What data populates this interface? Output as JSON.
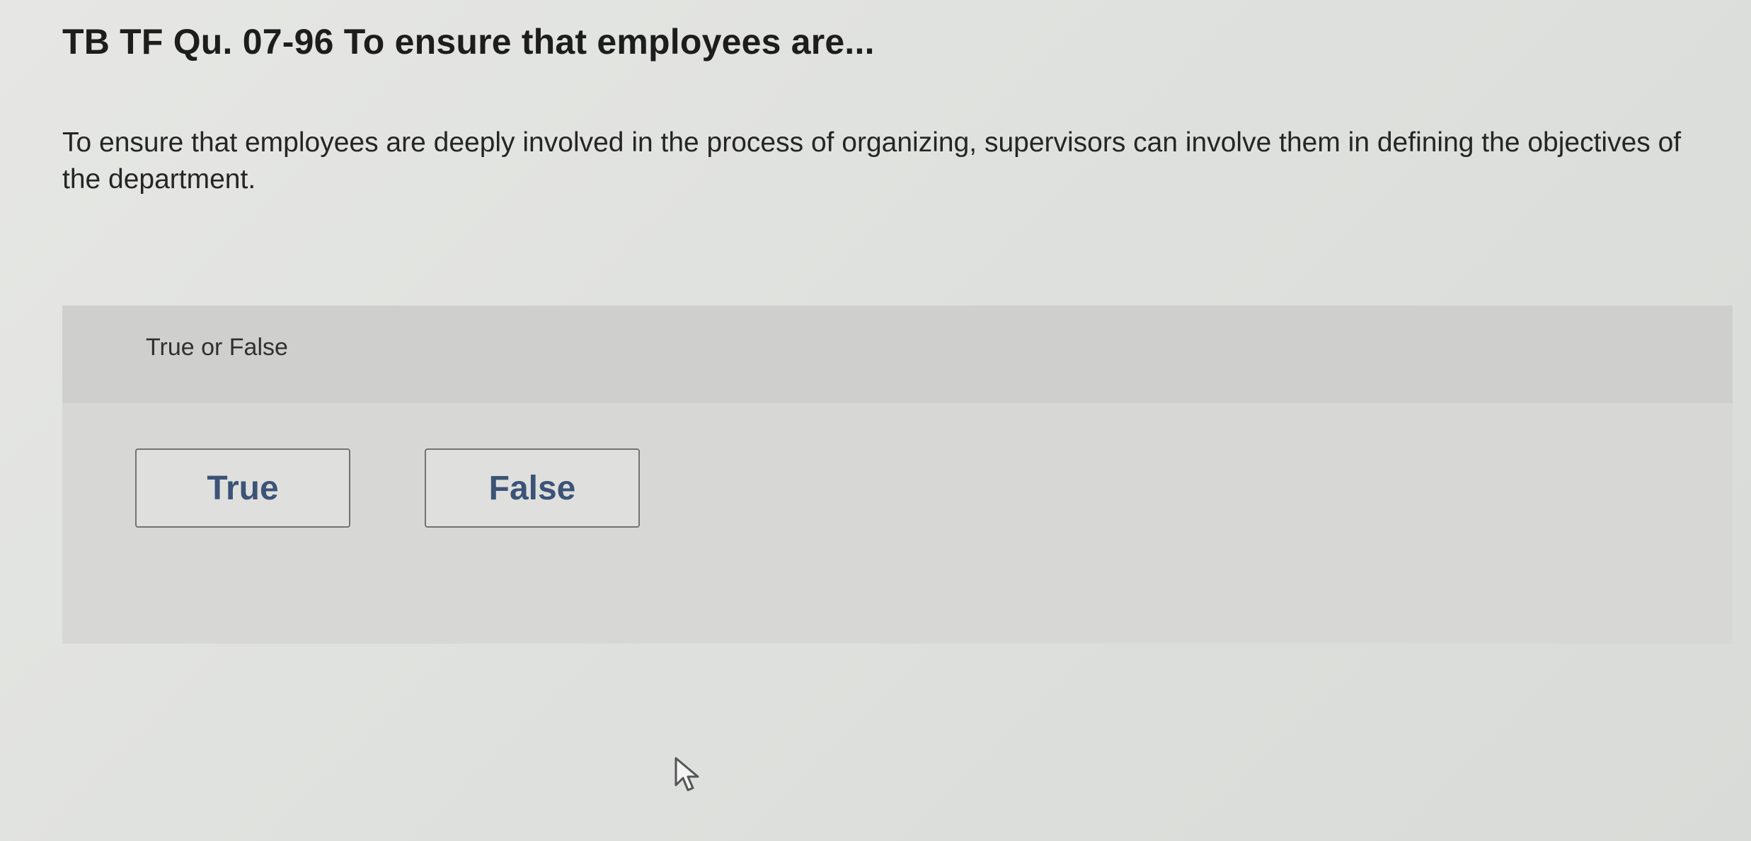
{
  "question": {
    "title": "TB TF Qu. 07-96 To ensure that employees are...",
    "text": "To ensure that employees are deeply involved in the process of organizing, supervisors can involve them in defining the objectives of the department."
  },
  "answer_panel": {
    "label": "True or False",
    "choices": [
      {
        "label": "True"
      },
      {
        "label": "False"
      }
    ]
  },
  "icons": {
    "cursor": "mouse-pointer-icon"
  },
  "colors": {
    "choice_text": "#3c5378",
    "choice_border": "#737373",
    "panel_background": "#d7d8d5"
  }
}
